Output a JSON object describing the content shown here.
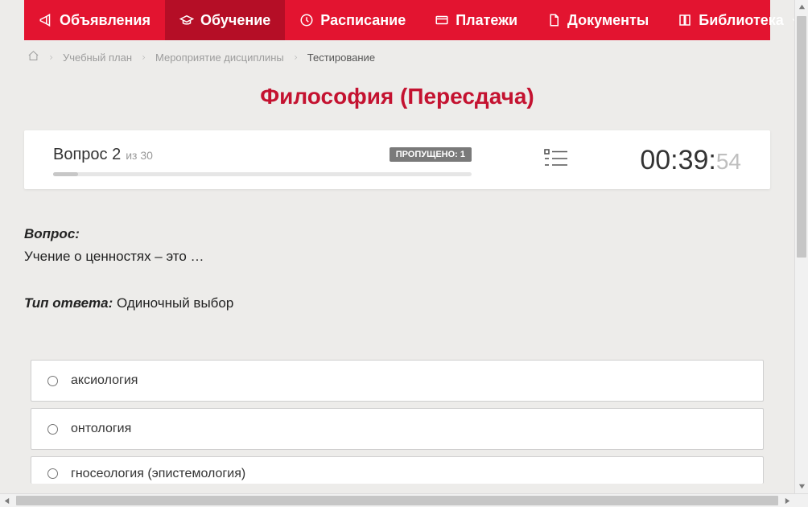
{
  "nav": {
    "items": [
      {
        "label": "Объявления",
        "icon": "megaphone-icon",
        "active": false
      },
      {
        "label": "Обучение",
        "icon": "graduation-icon",
        "active": true
      },
      {
        "label": "Расписание",
        "icon": "clock-icon",
        "active": false
      },
      {
        "label": "Платежи",
        "icon": "card-icon",
        "active": false
      },
      {
        "label": "Документы",
        "icon": "document-icon",
        "active": false
      },
      {
        "label": "Библиотека",
        "icon": "book-icon",
        "active": false,
        "dropdown": true
      }
    ]
  },
  "breadcrumb": {
    "items": [
      {
        "label": "Учебный план",
        "current": false
      },
      {
        "label": "Мероприятие дисциплины",
        "current": false
      },
      {
        "label": "Тестирование",
        "current": true
      }
    ]
  },
  "page": {
    "title": "Философия (Пересдача)"
  },
  "status": {
    "question_label": "Вопрос 2",
    "of_total": "из 30",
    "skipped_label": "ПРОПУЩЕНО: 1",
    "progress_percent": 6,
    "timer_main": "00:39:",
    "timer_sec": "54"
  },
  "question": {
    "heading": "Вопрос:",
    "text": "Учение о ценностях – это …",
    "answer_type_label": "Тип ответа:",
    "answer_type_value": "Одиночный выбор",
    "options": [
      {
        "text": "аксиология"
      },
      {
        "text": "онтология"
      },
      {
        "text": "гносеология (эпистемология)"
      }
    ]
  },
  "colors": {
    "brand": "#e31430",
    "brand_dark": "#b50e26",
    "title": "#c41230"
  }
}
